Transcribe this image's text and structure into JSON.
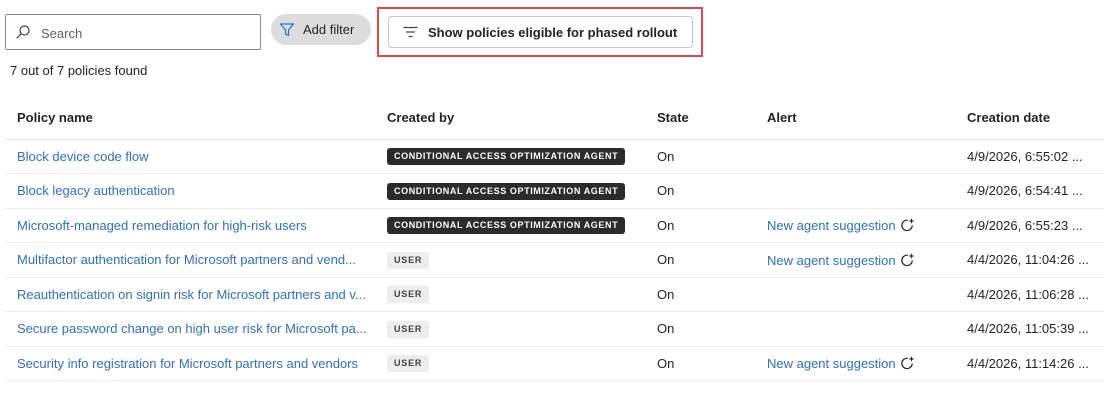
{
  "toolbar": {
    "search_placeholder": "Search",
    "search_icon": "search-icon",
    "add_filter_label": "Add filter",
    "add_filter_icon": "filter-icon",
    "phased_label": "Show policies eligible for phased rollout",
    "phased_icon": "filter-lines-icon",
    "highlight_color": "#e0484f"
  },
  "summary": {
    "count_text": "7 out of 7 policies found"
  },
  "table": {
    "headers": {
      "policy_name": "Policy name",
      "created_by": "Created by",
      "state": "State",
      "alert": "Alert",
      "creation_date": "Creation date"
    },
    "rows": [
      {
        "name": "Block device code flow",
        "created_by": "CONDITIONAL ACCESS OPTIMIZATION AGENT",
        "creator_type": "agent",
        "state": "On",
        "alert": "",
        "date": "4/9/2026, 6:55:02 ..."
      },
      {
        "name": "Block legacy authentication",
        "created_by": "CONDITIONAL ACCESS OPTIMIZATION AGENT",
        "creator_type": "agent",
        "state": "On",
        "alert": "",
        "date": "4/9/2026, 6:54:41 ..."
      },
      {
        "name": "Microsoft-managed remediation for high-risk users",
        "created_by": "CONDITIONAL ACCESS OPTIMIZATION AGENT",
        "creator_type": "agent",
        "state": "On",
        "alert": "New agent suggestion",
        "date": "4/9/2026, 6:55:23 ..."
      },
      {
        "name": "Multifactor authentication for Microsoft partners and vend...",
        "created_by": "USER",
        "creator_type": "user",
        "state": "On",
        "alert": "New agent suggestion",
        "date": "4/4/2026, 11:04:26 ..."
      },
      {
        "name": "Reauthentication on signin risk for Microsoft partners and v...",
        "created_by": "USER",
        "creator_type": "user",
        "state": "On",
        "alert": "",
        "date": "4/4/2026, 11:06:28 ..."
      },
      {
        "name": "Secure password change on high user risk for Microsoft pa...",
        "created_by": "USER",
        "creator_type": "user",
        "state": "On",
        "alert": "",
        "date": "4/4/2026, 11:05:39 ..."
      },
      {
        "name": "Security info registration for Microsoft partners and vendors",
        "created_by": "USER",
        "creator_type": "user",
        "state": "On",
        "alert": "New agent suggestion",
        "date": "4/4/2026, 11:14:26 ..."
      }
    ],
    "alert_icon": "agent-sparkle-icon"
  },
  "colors": {
    "link": "#2f6fc0",
    "agent_badge_bg": "#2b2b2b",
    "user_badge_bg": "#ededed"
  }
}
